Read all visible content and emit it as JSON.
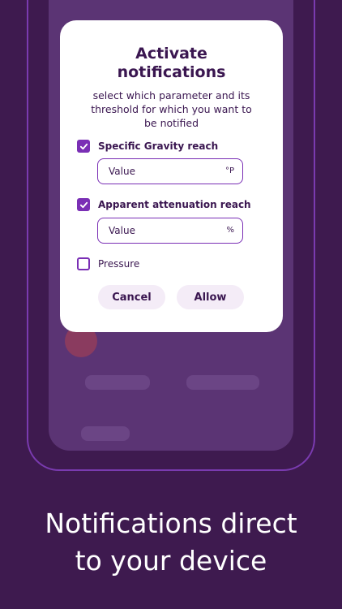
{
  "dialog": {
    "title_line1": "Activate",
    "title_line2": "notifications",
    "subtitle_line1": "select which parameter and its",
    "subtitle_line2": "threshold for which you want to",
    "subtitle_line3": "be notified",
    "options": [
      {
        "label": "Specific Gravity reach",
        "checked": true,
        "value_placeholder": "Value",
        "unit": "°P"
      },
      {
        "label": "Apparent attenuation reach",
        "checked": true,
        "value_placeholder": "Value",
        "unit": "%"
      },
      {
        "label": "Pressure",
        "checked": false
      }
    ],
    "cancel_label": "Cancel",
    "allow_label": "Allow"
  },
  "headline": {
    "line1": "Notifications direct",
    "line2": "to your device"
  },
  "colors": {
    "background": "#3e1a4f",
    "accent": "#7a2fb5",
    "dialog": "#ffffff",
    "text": "#3a1650"
  }
}
